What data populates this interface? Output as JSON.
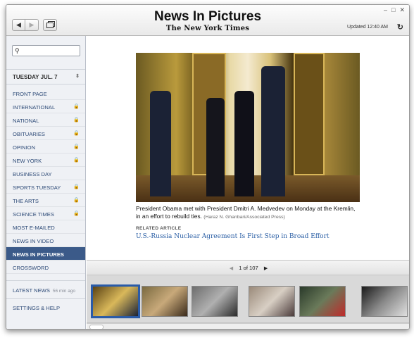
{
  "header": {
    "title": "News In Pictures",
    "masthead": "The New York Times",
    "updated_label": "Updated",
    "updated_time": "12:40 AM",
    "back_glyph": "◀",
    "forward_glyph": "▶",
    "refresh_glyph": "↻",
    "window_controls": [
      "–",
      "□",
      "✕"
    ]
  },
  "sidebar": {
    "search_icon": "⚲",
    "date_label": "TUESDAY JUL. 7",
    "date_arrows": "⇕",
    "lock_glyph": "🔒",
    "sections": [
      {
        "label": "Front Page",
        "locked": false
      },
      {
        "label": "International",
        "locked": true
      },
      {
        "label": "National",
        "locked": true
      },
      {
        "label": "Obituaries",
        "locked": true
      },
      {
        "label": "Opinion",
        "locked": true
      },
      {
        "label": "New York",
        "locked": true
      },
      {
        "label": "Business Day",
        "locked": false
      },
      {
        "label": "Sports Tuesday",
        "locked": true
      },
      {
        "label": "The Arts",
        "locked": true
      },
      {
        "label": "Science Times",
        "locked": true
      },
      {
        "label": "Most E-Mailed",
        "locked": false
      },
      {
        "label": "News in Video",
        "locked": false
      },
      {
        "label": "News in Pictures",
        "locked": false,
        "active": true
      },
      {
        "label": "Crossword",
        "locked": false
      }
    ],
    "latest_news": "LATEST NEWS",
    "latest_ago": "56 min ago",
    "settings": "SETTINGS & HELP"
  },
  "article": {
    "caption": "President Obama met with President Dmitri A. Medvedev on Monday at the Kremlin, in an effort to rebuild ties.",
    "credit": "(Haraz N. Ghanbari/Associated Press)",
    "related_label": "RELATED ARTICLE",
    "related_link": "U.S.-Russia Nuclear Agreement Is First Step in Broad Effort"
  },
  "pager": {
    "prev_glyph": "◀",
    "next_glyph": "▶",
    "text": "1 of 107"
  },
  "filmstrip": {
    "thumbs": [
      {
        "name": "thumb-kremlin",
        "active": true,
        "colors": [
          "#5a4214",
          "#d9b85a",
          "#1b2235"
        ]
      },
      {
        "name": "thumb-room",
        "active": false,
        "colors": [
          "#7a6a40",
          "#c8a97a",
          "#3a2a1a"
        ]
      },
      {
        "name": "thumb-street",
        "active": false,
        "colors": [
          "#6d6d6d",
          "#b0b0b0",
          "#2a2a2a"
        ]
      },
      {
        "name": "thumb-hospital",
        "active": false,
        "colors": [
          "#9a8a7a",
          "#d8cfc4",
          "#4a3a3a"
        ]
      },
      {
        "name": "thumb-military",
        "active": false,
        "colors": [
          "#2a3a2a",
          "#6a7a5a",
          "#c02a2a"
        ]
      },
      {
        "name": "thumb-press",
        "active": false,
        "colors": [
          "#1a1a1a",
          "#8a8a8a",
          "#e0e0e0"
        ]
      }
    ]
  }
}
